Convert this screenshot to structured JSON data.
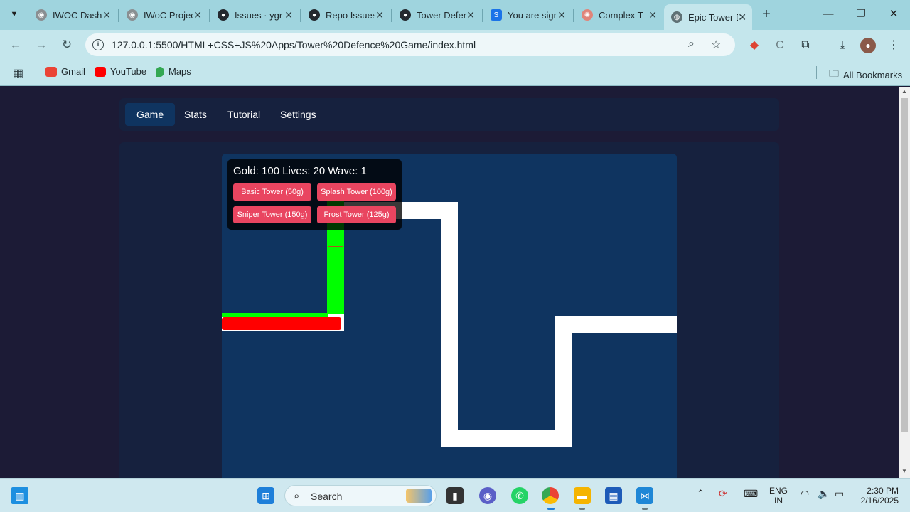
{
  "browser": {
    "tabs": [
      {
        "title": "IWOC Dashboard"
      },
      {
        "title": "IWoC Projects"
      },
      {
        "title": "Issues · ygr"
      },
      {
        "title": "Repo Issues"
      },
      {
        "title": "Tower Defence"
      },
      {
        "title": "You are signed"
      },
      {
        "title": "Complex T"
      },
      {
        "title": "Epic Tower Defence"
      }
    ],
    "url": "127.0.0.1:5500/HTML+CSS+JS%20Apps/Tower%20Defence%20Game/index.html",
    "bookmarks": [
      {
        "label": "Gmail"
      },
      {
        "label": "YouTube"
      },
      {
        "label": "Maps"
      }
    ],
    "all_bookmarks_label": "All Bookmarks"
  },
  "game": {
    "nav": [
      {
        "label": "Game"
      },
      {
        "label": "Stats"
      },
      {
        "label": "Tutorial"
      },
      {
        "label": "Settings"
      }
    ],
    "hud": {
      "stats_text": "Gold: 100 Lives: 20 Wave: 1",
      "gold": 100,
      "lives": 20,
      "wave": 1
    },
    "tower_buttons": [
      {
        "label": "Basic Tower (50g)"
      },
      {
        "label": "Splash Tower (100g)"
      },
      {
        "label": "Sniper Tower (150g)"
      },
      {
        "label": "Frost Tower (125g)"
      }
    ],
    "colors": {
      "page_bg": "#1c1b36",
      "panel_bg": "#16213e",
      "board_bg": "#0f3460",
      "path": "#ffffff",
      "button": "#e94560",
      "enemy_green": "#00ff00",
      "enemy_red": "#ff0000"
    }
  },
  "taskbar": {
    "search_placeholder": "Search",
    "language": "ENG",
    "region": "IN",
    "time": "2:30 PM",
    "date": "2/16/2025"
  }
}
